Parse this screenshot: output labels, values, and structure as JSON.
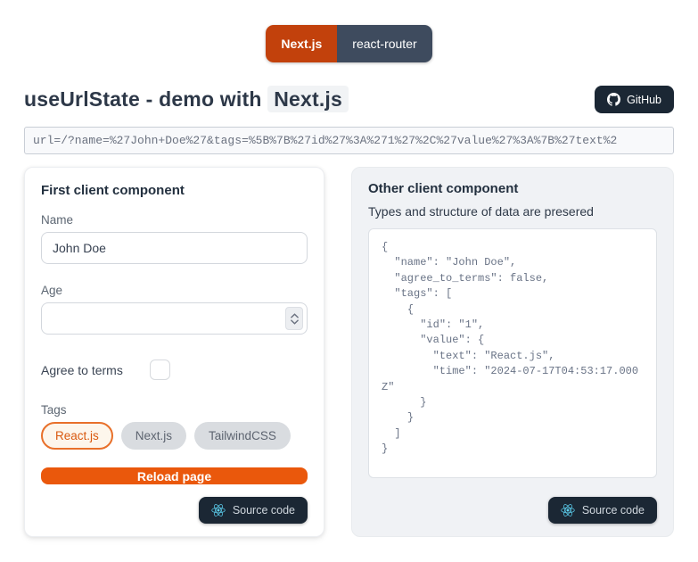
{
  "toggle": {
    "nextjs_label": "Next.js",
    "react_router_label": "react-router"
  },
  "header": {
    "title_prefix": "useUrlState - demo with ",
    "title_highlight": "Next.js",
    "github_label": "GitHub"
  },
  "url_bar": {
    "value": "url=/?name=%27John+Doe%27&tags=%5B%7B%27id%27%3A%271%27%2C%27value%27%3A%7B%27text%2"
  },
  "left_card": {
    "title": "First client component",
    "name_label": "Name",
    "name_value": "John Doe",
    "age_label": "Age",
    "age_value": "",
    "agree_label": "Agree to terms",
    "agree_checked": false,
    "tags_label": "Tags",
    "tags": [
      {
        "label": "React.js",
        "active": true
      },
      {
        "label": "Next.js",
        "active": false
      },
      {
        "label": "TailwindCSS",
        "active": false
      }
    ],
    "reload_label": "Reload page",
    "source_code_label": "Source code"
  },
  "right_card": {
    "title": "Other client component",
    "subtitle": "Types and structure of data are presered",
    "code": "{\n  \"name\": \"John Doe\",\n  \"agree_to_terms\": false,\n  \"tags\": [\n    {\n      \"id\": \"1\",\n      \"value\": {\n        \"text\": \"React.js\",\n        \"time\": \"2024-07-17T04:53:17.000Z\"\n      }\n    }\n  ]\n}",
    "source_code_label": "Source code"
  },
  "icons": {
    "github": "github-octocat-icon",
    "react": "react-atom-icon",
    "stepper": "number-stepper-chevrons"
  },
  "colors": {
    "accent_orange": "#ea580c",
    "toggle_orange": "#c2410c",
    "toggle_slate": "#3e4b5e",
    "dark_navy_button": "#1b2734",
    "react_blue": "#5ed3f3",
    "right_card_bg": "#f0f2f5",
    "code_text": "#697386"
  }
}
